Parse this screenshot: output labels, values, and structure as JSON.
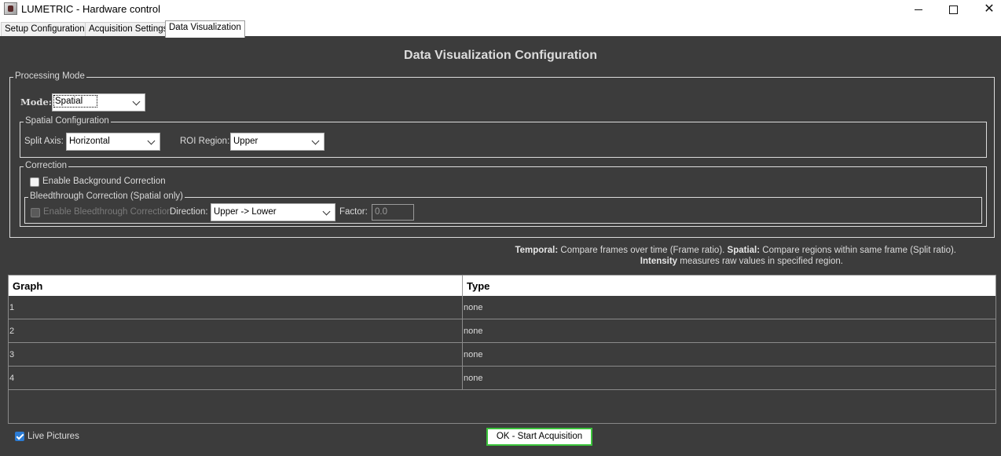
{
  "window": {
    "title": "LUMETRIC - Hardware control"
  },
  "tabs": [
    {
      "label": "Setup Configuration"
    },
    {
      "label": "Acquisition Settings"
    },
    {
      "label": "Data Visualization"
    }
  ],
  "page_title": "Data Visualization Configuration",
  "processing": {
    "legend": "Processing Mode",
    "mode_label": "Mode:",
    "mode_value": "Spatial",
    "spatial": {
      "legend": "Spatial Configuration",
      "split_axis_label": "Split Axis:",
      "split_axis_value": "Horizontal",
      "roi_label": "ROI Region:",
      "roi_value": "Upper"
    },
    "correction": {
      "legend": "Correction",
      "background_label": "Enable Background Correction",
      "background_checked": false,
      "bleed": {
        "legend": "Bleedthrough Correction (Spatial only)",
        "enable_label": "Enable Bleedthrough Correction",
        "enable_checked": false,
        "direction_label": "Direction:",
        "direction_value": "Upper -> Lower",
        "factor_label": "Factor:",
        "factor_value": "0.0"
      }
    }
  },
  "hint": {
    "temporal_bold": "Temporal:",
    "temporal_text": " Compare frames over time (Frame ratio). ",
    "spatial_bold": "Spatial:",
    "spatial_text": " Compare regions within same frame (Split ratio).",
    "intensity_bold": "Intensity",
    "intensity_text": " measures raw values in specified region."
  },
  "table": {
    "headers": [
      "Graph",
      "Type"
    ],
    "rows": [
      {
        "graph": "1",
        "type": "none"
      },
      {
        "graph": "2",
        "type": "none"
      },
      {
        "graph": "3",
        "type": "none"
      },
      {
        "graph": "4",
        "type": "none"
      }
    ]
  },
  "footer": {
    "live_label": "Live Pictures",
    "live_checked": true,
    "ok_label": "OK - Start Acquisition"
  },
  "colors": {
    "background": "#3c3c3c",
    "ok_border": "#3cc43c",
    "checkbox_checked": "#2b7bd4"
  }
}
